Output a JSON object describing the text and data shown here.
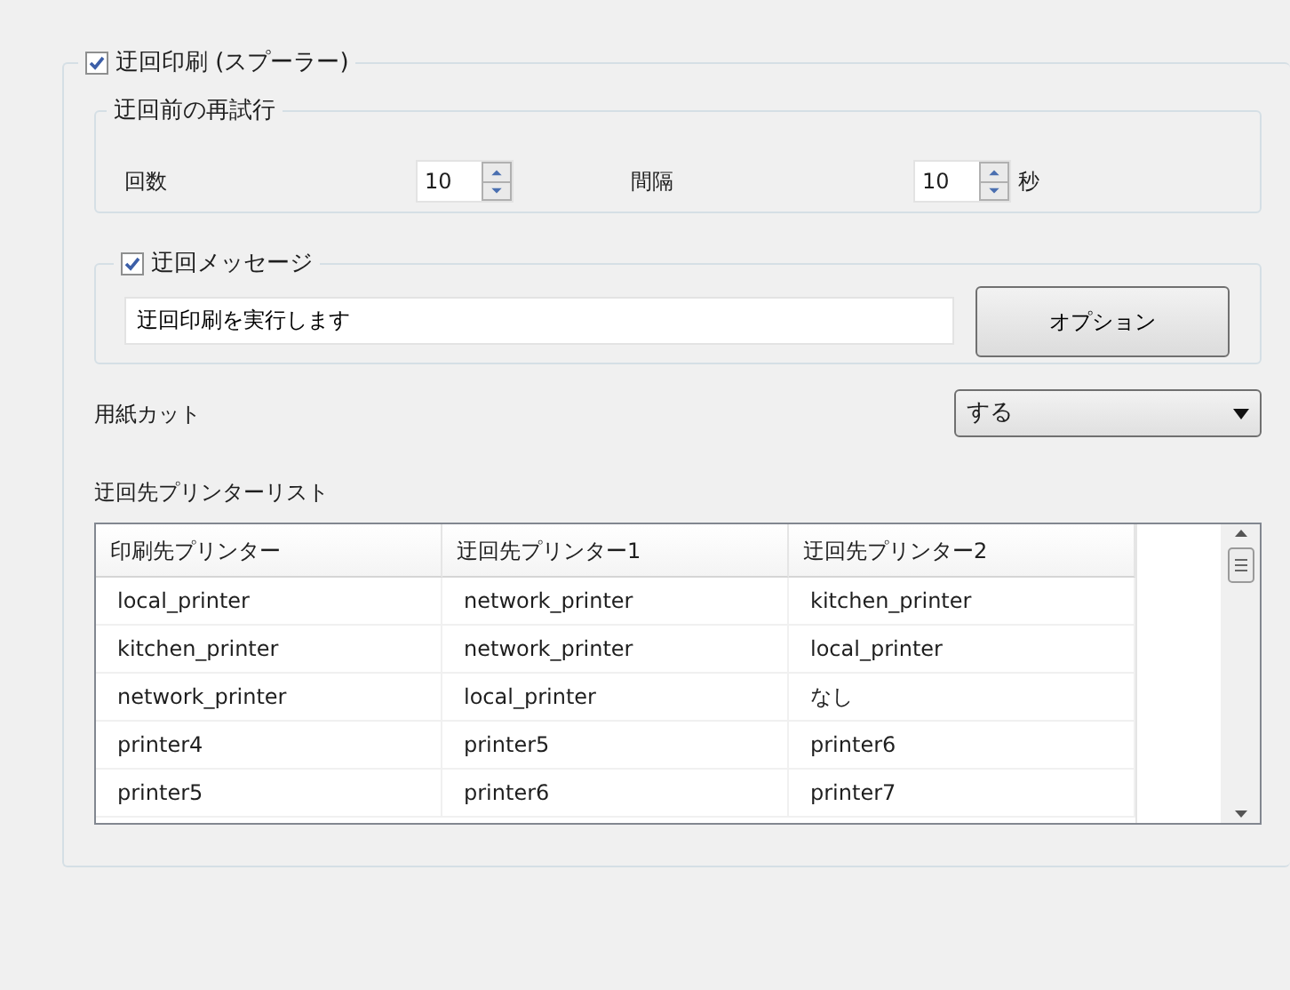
{
  "spooler": {
    "label": "迂回印刷 (スプーラー)",
    "checked": true,
    "retry": {
      "title": "迂回前の再試行",
      "count_label": "回数",
      "count_value": "10",
      "interval_label": "間隔",
      "interval_value": "10",
      "interval_unit": "秒"
    },
    "message": {
      "label": "迂回メッセージ",
      "checked": true,
      "value": "迂回印刷を実行します",
      "button": "オプション"
    },
    "paper_cut": {
      "label": "用紙カット",
      "value": "する"
    },
    "list": {
      "title": "迂回先プリンターリスト",
      "columns": [
        "印刷先プリンター",
        "迂回先プリンター1",
        "迂回先プリンター2"
      ],
      "rows": [
        [
          "local_printer",
          "network_printer",
          "kitchen_printer"
        ],
        [
          "kitchen_printer",
          "network_printer",
          "local_printer"
        ],
        [
          "network_printer",
          "local_printer",
          "なし"
        ],
        [
          "printer4",
          "printer5",
          "printer6"
        ],
        [
          "printer5",
          "printer6",
          "printer7"
        ]
      ]
    }
  }
}
